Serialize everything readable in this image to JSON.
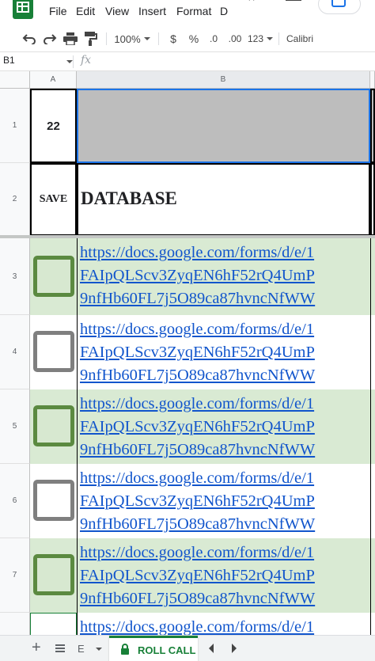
{
  "menu": {
    "items": [
      "File",
      "Edit",
      "View",
      "Insert",
      "Format"
    ],
    "more": "D"
  },
  "toolbar": {
    "zoom": "100%",
    "currency": "$",
    "percent": "%",
    "decrease_decimal": ".0",
    "increase_decimal": ".00",
    "more_formats": "123",
    "font": "Calibri"
  },
  "formula_bar": {
    "name_box": "B1",
    "fx": "fx",
    "value": ""
  },
  "columns": [
    "A",
    "B"
  ],
  "rows": [
    {
      "num": "1",
      "a": "22",
      "b": ""
    },
    {
      "num": "2",
      "a": "SAVE",
      "b": "DATABASE"
    },
    {
      "num": "3",
      "checked": true,
      "link": [
        "https://docs.google.com/forms/d/e/1",
        "FAIpQLScv3ZyqEN6hF52rQ4UmP",
        "9nfHb60FL7j5O89ca87hvncNfWW"
      ]
    },
    {
      "num": "4",
      "checked": false,
      "link": [
        "https://docs.google.com/forms/d/e/1",
        "FAIpQLScv3ZyqEN6hF52rQ4UmP",
        "9nfHb60FL7j5O89ca87hvncNfWW"
      ]
    },
    {
      "num": "5",
      "checked": true,
      "link": [
        "https://docs.google.com/forms/d/e/1",
        "FAIpQLScv3ZyqEN6hF52rQ4UmP",
        "9nfHb60FL7j5O89ca87hvncNfWW"
      ]
    },
    {
      "num": "6",
      "checked": false,
      "link": [
        "https://docs.google.com/forms/d/e/1",
        "FAIpQLScv3ZyqEN6hF52rQ4UmP",
        "9nfHb60FL7j5O89ca87hvncNfWW"
      ]
    },
    {
      "num": "7",
      "checked": true,
      "link": [
        "https://docs.google.com/forms/d/e/1",
        "FAIpQLScv3ZyqEN6hF52rQ4UmP",
        "9nfHb60FL7j5O89ca87hvncNfWW"
      ]
    },
    {
      "num": "",
      "checked": false,
      "link": [
        "https://docs.google.com/forms/d/e/1"
      ]
    }
  ],
  "sheets": {
    "add_label": "+",
    "previous_tab_fragment": "E",
    "active": "ROLL CALL"
  },
  "colors": {
    "brand_green": "#188038",
    "selection_blue": "#1a73e8",
    "checked_fill": "#d7e8d0",
    "checked_border": "#5b8a40",
    "link_blue": "#1155cc",
    "header_fill": "#bdbdbd"
  },
  "icons": [
    "sheets-logo-icon",
    "history-icon",
    "comment-icon",
    "share-lock-icon",
    "undo-icon",
    "redo-icon",
    "print-icon",
    "paint-format-icon",
    "fx-icon",
    "add-sheet-icon",
    "all-sheets-icon",
    "lock-icon",
    "chevron-left-icon",
    "chevron-right-icon"
  ]
}
